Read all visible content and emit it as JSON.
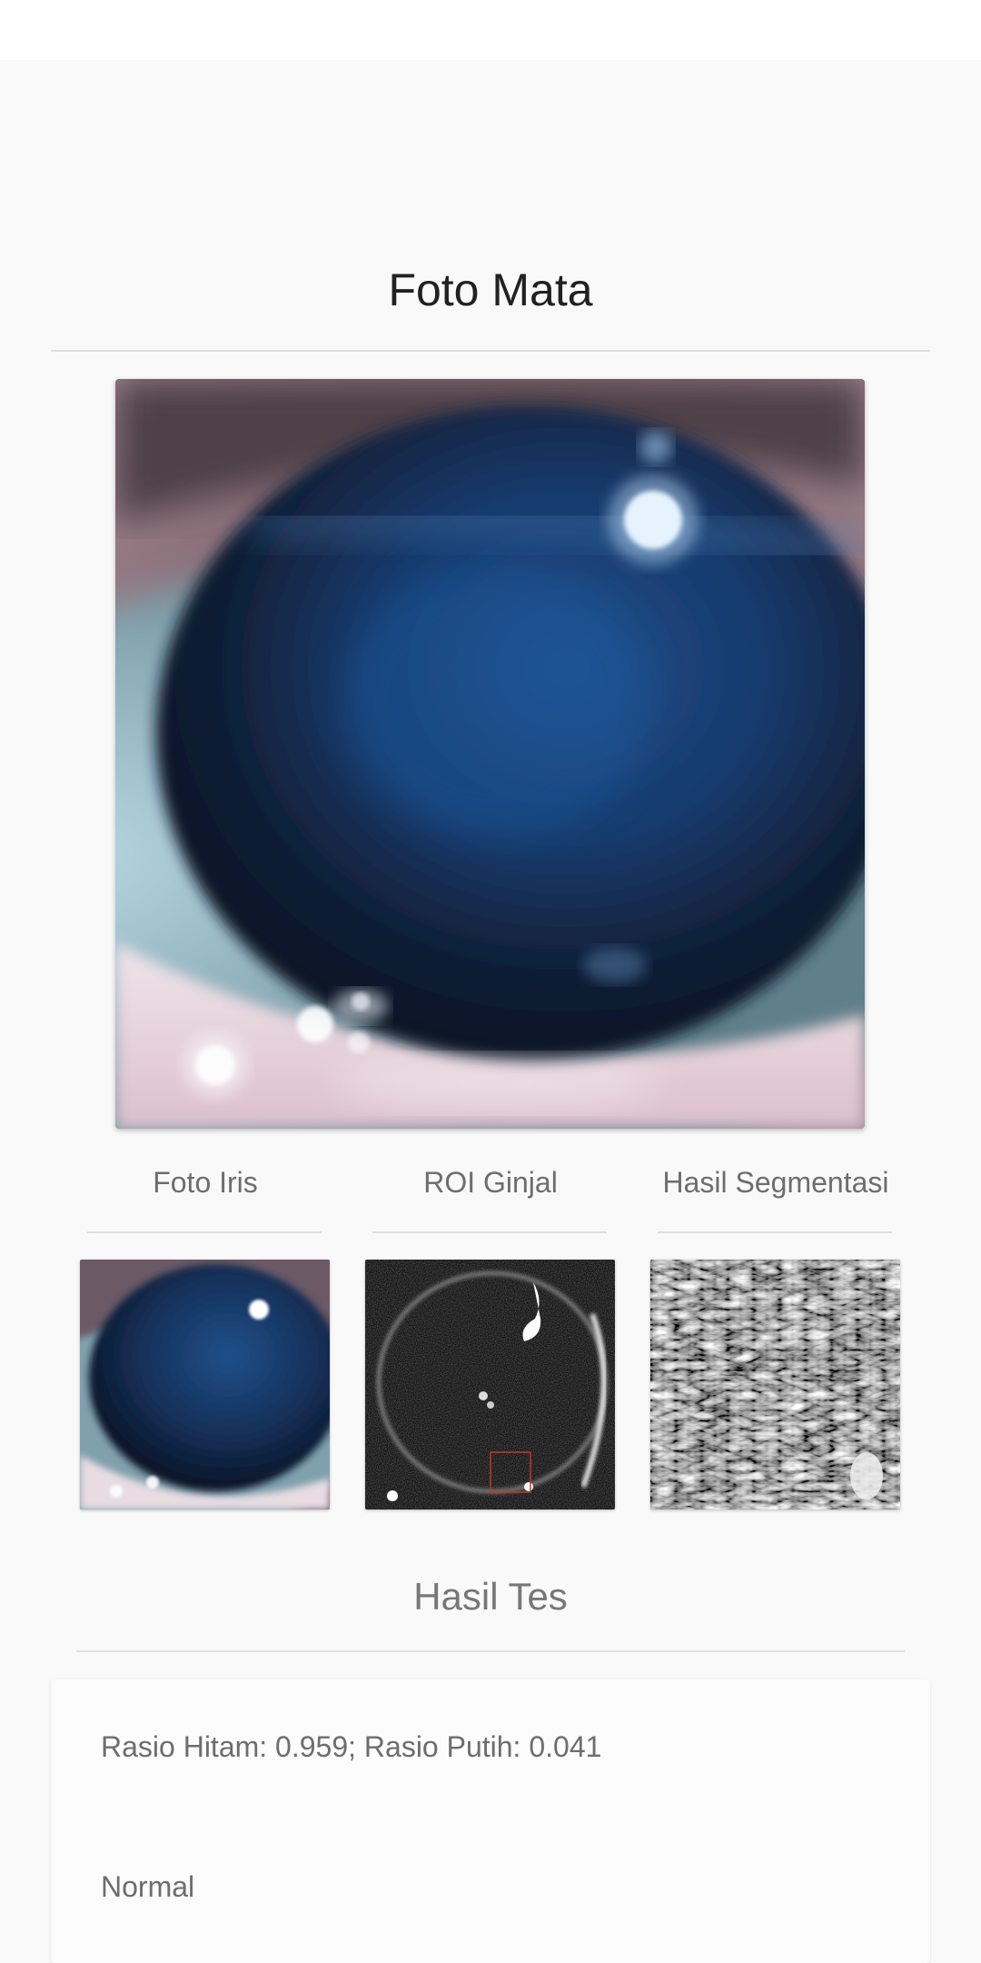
{
  "screen": {
    "title": "Foto Mata"
  },
  "main_image": {
    "name": "eye-photo",
    "alt": "Foto Mata"
  },
  "thumbnails": [
    {
      "label": "Foto Iris"
    },
    {
      "label": "ROI Ginjal"
    },
    {
      "label": "Hasil Segmentasi"
    }
  ],
  "results": {
    "heading": "Hasil Tes",
    "ratio_text": "Rasio Hitam: 0.959; Rasio Putih: 0.041",
    "status": "Normal"
  },
  "colors": {
    "background": "#f9f9f9",
    "title_text": "#212121",
    "secondary_text": "#6d6d6d",
    "divider": "#dedede",
    "roi_box": "#c0392b"
  }
}
